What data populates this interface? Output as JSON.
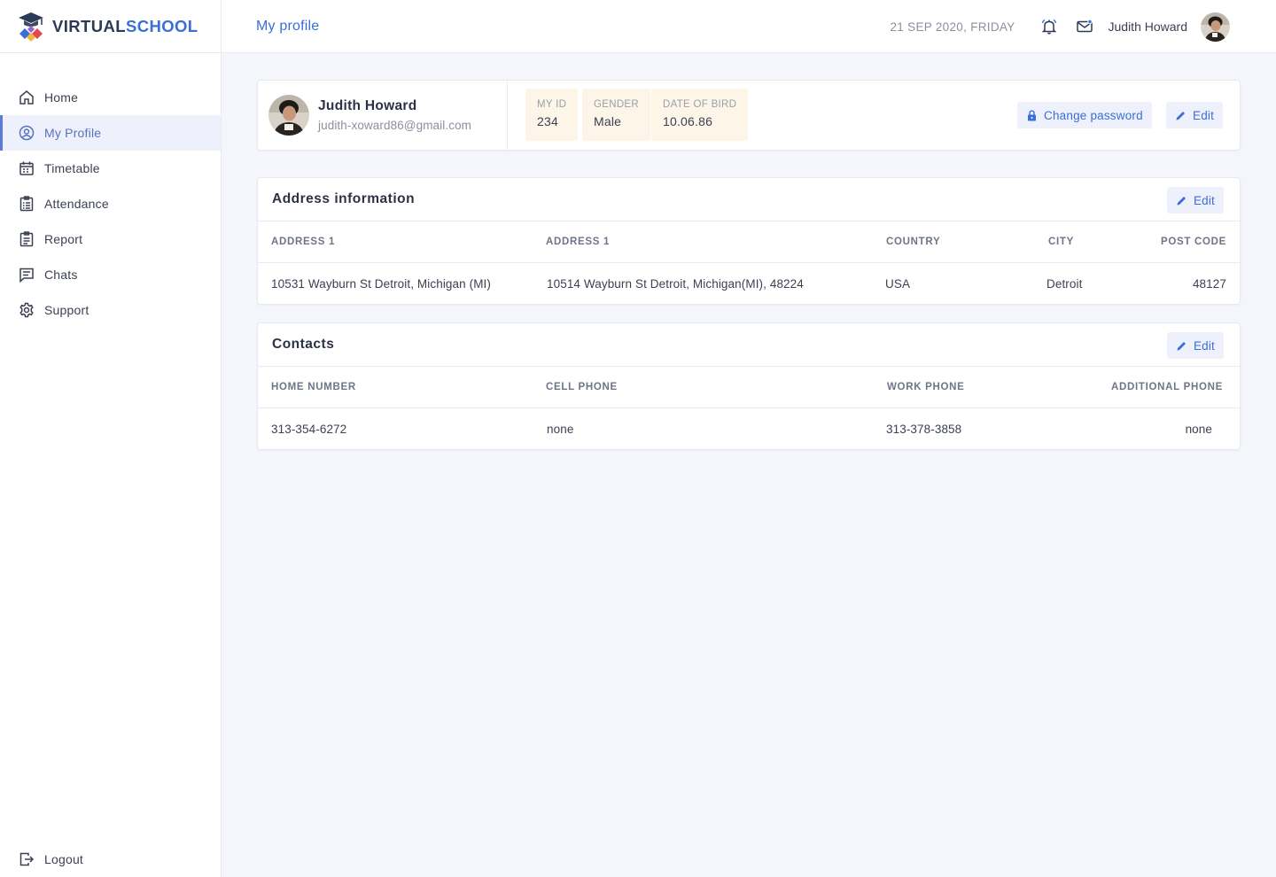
{
  "brand": {
    "name_part1": "VIRTUAL",
    "name_part2": "SCHOOL"
  },
  "sidebar": {
    "items": [
      {
        "label": "Home",
        "icon": "home-icon"
      },
      {
        "label": "My Profile",
        "icon": "profile-icon",
        "active": true
      },
      {
        "label": "Timetable",
        "icon": "calendar-icon"
      },
      {
        "label": "Attendance",
        "icon": "checklist-icon"
      },
      {
        "label": "Report",
        "icon": "report-icon"
      },
      {
        "label": "Chats",
        "icon": "chat-icon"
      },
      {
        "label": "Support",
        "icon": "gear-icon"
      }
    ],
    "logout_label": "Logout"
  },
  "header": {
    "title": "My profile",
    "date": "21 SEP 2020, FRIDAY",
    "user_name": "Judith Howard"
  },
  "profile": {
    "name": "Judith Howard",
    "email": "judith-xoward86@gmail.com",
    "chips": [
      {
        "label": "MY ID",
        "value": "234"
      },
      {
        "label": "GENDER",
        "value": "Male"
      },
      {
        "label": "DATE OF BIRD",
        "value": "10.06.86"
      }
    ],
    "change_password_label": "Change password",
    "edit_label": "Edit"
  },
  "address": {
    "title": "Address information",
    "edit_label": "Edit",
    "columns": [
      "ADDRESS 1",
      "ADDRESS 1",
      "COUNTRY",
      "CITY",
      "POST CODE"
    ],
    "row": [
      "10531 Wayburn St Detroit, Michigan (MI)",
      "10514 Wayburn St  Detroit, Michigan(MI), 48224",
      "USA",
      "Detroit",
      "48127"
    ]
  },
  "contacts": {
    "title": "Contacts",
    "edit_label": "Edit",
    "columns": [
      "HOME NUMBER",
      "CELL PHONE",
      "WORK PHONE",
      "ADDITIONAL PHONE"
    ],
    "row": [
      "313-354-6272",
      "none",
      "313-378-3858",
      "none"
    ]
  },
  "colors": {
    "accent": "#3a6fd8",
    "active_bg": "#eef1fb",
    "chip_bg": "#fdf5e8",
    "page_bg": "#f4f6fc"
  }
}
